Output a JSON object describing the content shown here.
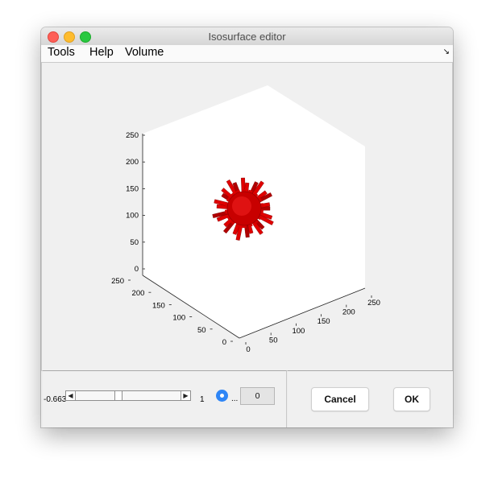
{
  "window": {
    "title": "Isosurface editor"
  },
  "menubar": {
    "items": [
      "Tools",
      "Help",
      "Volume"
    ],
    "overflow_icon": "arrow-icon"
  },
  "axes": {
    "z_ticks": [
      "0",
      "50",
      "100",
      "150",
      "200",
      "250"
    ],
    "x_ticks": [
      "0",
      "50",
      "100",
      "150",
      "200",
      "250"
    ],
    "y_ticks": [
      "0",
      "50",
      "100",
      "150",
      "200",
      "250"
    ],
    "object_color": "#e00000"
  },
  "controls": {
    "slider_min": "-0.663",
    "slider_max": "1",
    "slider_value_fraction": 0.4,
    "radio_label": "...",
    "value_field": "0"
  },
  "buttons": {
    "cancel": "Cancel",
    "ok": "OK"
  }
}
